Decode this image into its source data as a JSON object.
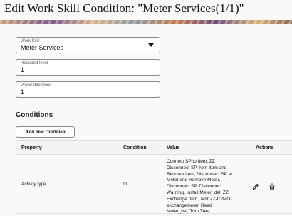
{
  "page": {
    "title": "Edit Work Skill Condition: \"Meter Services(1/1)\""
  },
  "form": {
    "work_skill": {
      "label": "Work Skill",
      "value": "Meter Services"
    },
    "required_level": {
      "label": "Required level",
      "value": "1"
    },
    "preferable_level": {
      "label": "Preferable level",
      "value": "1"
    }
  },
  "conditions": {
    "heading": "Conditions",
    "add_button_label": "Add new condition",
    "columns": {
      "property": "Property",
      "condition": "Condition",
      "value": "Value",
      "actions": "Actions"
    },
    "rows": [
      {
        "property": "Activity type",
        "condition": "In",
        "value": "Connect SP to Item, ZZ Disconnect SP from Item and Remove Item, Disconnect SP at Meter and Remove Meter, Disconnect SP, Disconnect Warning, Install Meter_del, ZZ Exchange Item, Test ZZ-C2MO-exchangemeter, Read Meter_del, Trim Tree"
      }
    ]
  },
  "icons": {
    "edit": "pencil-icon",
    "delete": "trash-icon",
    "dropdown": "chevron-down-icon"
  }
}
